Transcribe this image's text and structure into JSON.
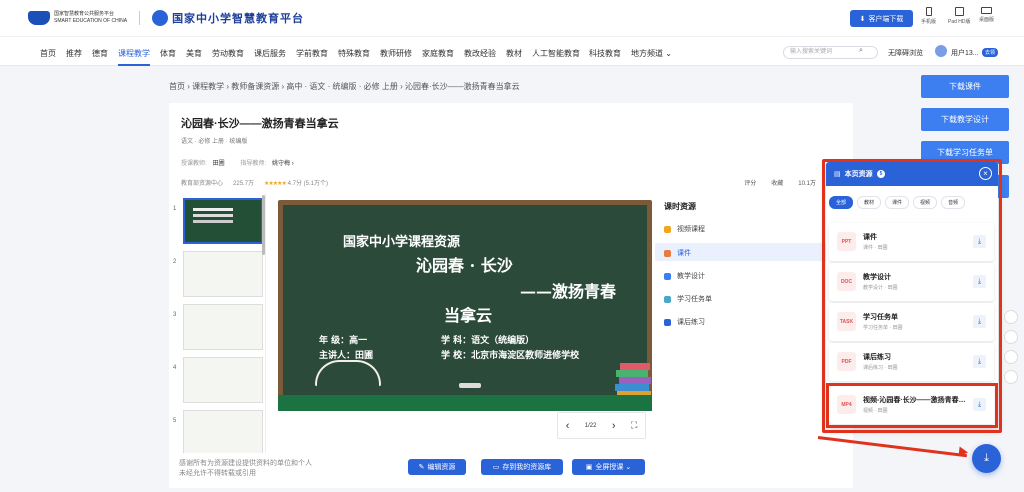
{
  "header": {
    "platform_small_cn": "国家智慧教育公共服务平台",
    "platform_small_en": "SMART EDUCATION OF CHINA",
    "platform_main": "国家中小学智慧教育平台",
    "client_download": "客户端下载",
    "devices": [
      "手机版",
      "Pad HD版",
      "桌面版"
    ]
  },
  "nav": {
    "items": [
      "首页",
      "推荐",
      "德育",
      "课程教学",
      "体育",
      "美育",
      "劳动教育",
      "课后服务",
      "学前教育",
      "特殊教育",
      "教师研修",
      "家庭教育",
      "教改经验",
      "教材",
      "人工智能教育",
      "科技教育",
      "地方频道 ⌄"
    ],
    "active_index": 3,
    "search_placeholder": "输入搜索关键词",
    "accessibility": "无障碍浏览",
    "user": "用户13...",
    "user_badge": "去领"
  },
  "breadcrumb": "首页 › 课程教学 › 教师备课资源 › 高中 · 语文 · 统编版 · 必修 上册 › 沁园春·长沙——激扬青春当拿云",
  "resource": {
    "title": "沁园春·长沙——激扬青春当拿云",
    "subject": "语文 · 必修 上册 · 统编版",
    "teacher_label": "授课教师:",
    "teacher": "田圃",
    "guide_label": "指导教师:",
    "guide": "姚守梅 ›",
    "source": "教育部资源中心",
    "views": "225.7万",
    "rating": "4.7分",
    "rating_count": "(5.1万个)",
    "stars": "★★★★★",
    "actions": [
      "评分",
      "收藏",
      "10.1万",
      "分享"
    ]
  },
  "slide": {
    "line1": "国家中小学课程资源",
    "line2": "沁园春 · 长沙",
    "line3": "——激扬青春",
    "line4": "当拿云",
    "grade": "年  级：高一",
    "subject": "学  科：语文（统编版）",
    "lecturer": "主讲人：田圃",
    "school": "学  校：北京市海淀区教师进修学校",
    "page": "1/22"
  },
  "thumbnails": [
    "1",
    "2",
    "3",
    "4",
    "5"
  ],
  "lesson_resources": {
    "heading": "课时资源",
    "items": [
      "视频课程",
      "课件",
      "教学设计",
      "学习任务单",
      "课后练习"
    ],
    "active_index": 1
  },
  "footer": {
    "notice_line1": "感谢所有为资源建设提供资料的单位和个人",
    "notice_line2": "未经允许不得转载或引用",
    "edit": "编辑资源",
    "save": "存到我的资源库",
    "fullscreen": "全屏授课 ⌄"
  },
  "side_buttons": [
    "下载课件",
    "下载教学设计",
    "下载学习任务单",
    ""
  ],
  "popup": {
    "title": "本页资源",
    "count": "5",
    "tabs": [
      "全部",
      "教材",
      "课件",
      "视频",
      "音频"
    ],
    "items": [
      {
        "type": "PPT",
        "name": "课件",
        "meta": "课件 · 田圃"
      },
      {
        "type": "DOC",
        "name": "教学设计",
        "meta": "教学设计 · 田圃"
      },
      {
        "type": "TASK",
        "name": "学习任务单",
        "meta": "学习任务单 · 田圃"
      },
      {
        "type": "PDF",
        "name": "课后练习",
        "meta": "课后练习 · 田圃"
      },
      {
        "type": "MP4",
        "name": "视频-沁园春·长沙——激扬青春当拿云",
        "meta": "视频 · 田圃"
      }
    ]
  },
  "colors": {
    "brand": "#2a62d8",
    "highlight": "#e0331e",
    "board": "#2c4a3a"
  },
  "icons": [
    "download-icon",
    "close-icon",
    "star-icon",
    "phone-icon",
    "pad-icon",
    "desktop-icon"
  ]
}
